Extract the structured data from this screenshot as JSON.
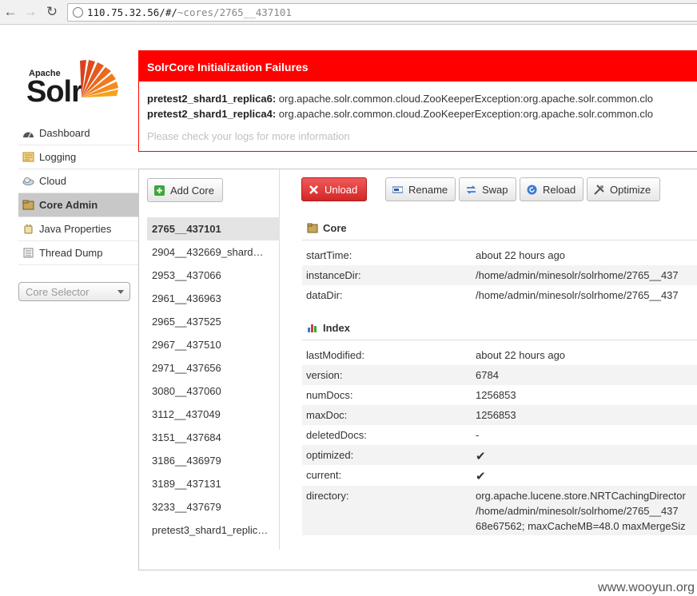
{
  "browser": {
    "url_host": "110.75.32.56/#/",
    "url_path": "~cores/2765__437101"
  },
  "logo": {
    "apache": "Apache",
    "solr": "Solr"
  },
  "sidebar": {
    "items": [
      {
        "label": "Dashboard",
        "icon": "dashboard-icon"
      },
      {
        "label": "Logging",
        "icon": "logging-icon"
      },
      {
        "label": "Cloud",
        "icon": "cloud-icon"
      },
      {
        "label": "Core Admin",
        "icon": "core-admin-icon",
        "active": true
      },
      {
        "label": "Java Properties",
        "icon": "java-icon"
      },
      {
        "label": "Thread Dump",
        "icon": "thread-dump-icon"
      }
    ],
    "core_selector": "Core Selector"
  },
  "error": {
    "title": "SolrCore Initialization Failures",
    "lines": [
      {
        "core": "pretest2_shard1_replica6:",
        "msg": "org.apache.solr.common.cloud.ZooKeeperException:org.apache.solr.common.clo"
      },
      {
        "core": "pretest2_shard1_replica4:",
        "msg": "org.apache.solr.common.cloud.ZooKeeperException:org.apache.solr.common.clo"
      }
    ],
    "hint": "Please check your logs for more information"
  },
  "toolbar": {
    "add_core": "Add Core",
    "unload": "Unload",
    "rename": "Rename",
    "swap": "Swap",
    "reload": "Reload",
    "optimize": "Optimize"
  },
  "cores": [
    "2765__437101",
    "2904__432669_shard…",
    "2953__437066",
    "2961__436963",
    "2965__437525",
    "2967__437510",
    "2971__437656",
    "3080__437060",
    "3112__437049",
    "3151__437684",
    "3186__436979",
    "3189__437131",
    "3233__437679",
    "pretest3_shard1_replic…"
  ],
  "core_section": {
    "title": "Core",
    "rows": [
      {
        "key": "startTime:",
        "value": "about 22 hours ago"
      },
      {
        "key": "instanceDir:",
        "value": "/home/admin/minesolr/solrhome/2765__437"
      },
      {
        "key": "dataDir:",
        "value": "/home/admin/minesolr/solrhome/2765__437"
      }
    ]
  },
  "index_section": {
    "title": "Index",
    "rows": [
      {
        "key": "lastModified:",
        "value": "about 22 hours ago"
      },
      {
        "key": "version:",
        "value": "6784"
      },
      {
        "key": "numDocs:",
        "value": "1256853"
      },
      {
        "key": "maxDoc:",
        "value": "1256853"
      },
      {
        "key": "deletedDocs:",
        "value": "-"
      },
      {
        "key": "optimized:",
        "value": "✔"
      },
      {
        "key": "current:",
        "value": "✔"
      }
    ],
    "directory_key": "directory:",
    "directory_lines": [
      "org.apache.lucene.store.NRTCachingDirector",
      "/home/admin/minesolr/solrhome/2765__437",
      "68e67562; maxCacheMB=48.0 maxMergeSiz"
    ]
  },
  "watermark": "www.wooyun.org"
}
